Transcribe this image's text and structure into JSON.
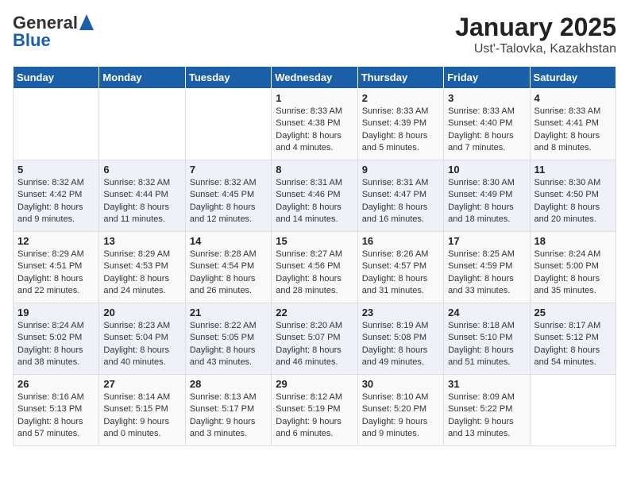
{
  "logo": {
    "general": "General",
    "blue": "Blue"
  },
  "title": "January 2025",
  "subtitle": "Ust'-Talovka, Kazakhstan",
  "days_of_week": [
    "Sunday",
    "Monday",
    "Tuesday",
    "Wednesday",
    "Thursday",
    "Friday",
    "Saturday"
  ],
  "weeks": [
    [
      {
        "day": "",
        "sunrise": "",
        "sunset": "",
        "daylight": "",
        "empty": true
      },
      {
        "day": "",
        "sunrise": "",
        "sunset": "",
        "daylight": "",
        "empty": true
      },
      {
        "day": "",
        "sunrise": "",
        "sunset": "",
        "daylight": "",
        "empty": true
      },
      {
        "day": "1",
        "sunrise": "Sunrise: 8:33 AM",
        "sunset": "Sunset: 4:38 PM",
        "daylight": "Daylight: 8 hours and 4 minutes."
      },
      {
        "day": "2",
        "sunrise": "Sunrise: 8:33 AM",
        "sunset": "Sunset: 4:39 PM",
        "daylight": "Daylight: 8 hours and 5 minutes."
      },
      {
        "day": "3",
        "sunrise": "Sunrise: 8:33 AM",
        "sunset": "Sunset: 4:40 PM",
        "daylight": "Daylight: 8 hours and 7 minutes."
      },
      {
        "day": "4",
        "sunrise": "Sunrise: 8:33 AM",
        "sunset": "Sunset: 4:41 PM",
        "daylight": "Daylight: 8 hours and 8 minutes."
      }
    ],
    [
      {
        "day": "5",
        "sunrise": "Sunrise: 8:32 AM",
        "sunset": "Sunset: 4:42 PM",
        "daylight": "Daylight: 8 hours and 9 minutes."
      },
      {
        "day": "6",
        "sunrise": "Sunrise: 8:32 AM",
        "sunset": "Sunset: 4:44 PM",
        "daylight": "Daylight: 8 hours and 11 minutes."
      },
      {
        "day": "7",
        "sunrise": "Sunrise: 8:32 AM",
        "sunset": "Sunset: 4:45 PM",
        "daylight": "Daylight: 8 hours and 12 minutes."
      },
      {
        "day": "8",
        "sunrise": "Sunrise: 8:31 AM",
        "sunset": "Sunset: 4:46 PM",
        "daylight": "Daylight: 8 hours and 14 minutes."
      },
      {
        "day": "9",
        "sunrise": "Sunrise: 8:31 AM",
        "sunset": "Sunset: 4:47 PM",
        "daylight": "Daylight: 8 hours and 16 minutes."
      },
      {
        "day": "10",
        "sunrise": "Sunrise: 8:30 AM",
        "sunset": "Sunset: 4:49 PM",
        "daylight": "Daylight: 8 hours and 18 minutes."
      },
      {
        "day": "11",
        "sunrise": "Sunrise: 8:30 AM",
        "sunset": "Sunset: 4:50 PM",
        "daylight": "Daylight: 8 hours and 20 minutes."
      }
    ],
    [
      {
        "day": "12",
        "sunrise": "Sunrise: 8:29 AM",
        "sunset": "Sunset: 4:51 PM",
        "daylight": "Daylight: 8 hours and 22 minutes."
      },
      {
        "day": "13",
        "sunrise": "Sunrise: 8:29 AM",
        "sunset": "Sunset: 4:53 PM",
        "daylight": "Daylight: 8 hours and 24 minutes."
      },
      {
        "day": "14",
        "sunrise": "Sunrise: 8:28 AM",
        "sunset": "Sunset: 4:54 PM",
        "daylight": "Daylight: 8 hours and 26 minutes."
      },
      {
        "day": "15",
        "sunrise": "Sunrise: 8:27 AM",
        "sunset": "Sunset: 4:56 PM",
        "daylight": "Daylight: 8 hours and 28 minutes."
      },
      {
        "day": "16",
        "sunrise": "Sunrise: 8:26 AM",
        "sunset": "Sunset: 4:57 PM",
        "daylight": "Daylight: 8 hours and 31 minutes."
      },
      {
        "day": "17",
        "sunrise": "Sunrise: 8:25 AM",
        "sunset": "Sunset: 4:59 PM",
        "daylight": "Daylight: 8 hours and 33 minutes."
      },
      {
        "day": "18",
        "sunrise": "Sunrise: 8:24 AM",
        "sunset": "Sunset: 5:00 PM",
        "daylight": "Daylight: 8 hours and 35 minutes."
      }
    ],
    [
      {
        "day": "19",
        "sunrise": "Sunrise: 8:24 AM",
        "sunset": "Sunset: 5:02 PM",
        "daylight": "Daylight: 8 hours and 38 minutes."
      },
      {
        "day": "20",
        "sunrise": "Sunrise: 8:23 AM",
        "sunset": "Sunset: 5:04 PM",
        "daylight": "Daylight: 8 hours and 40 minutes."
      },
      {
        "day": "21",
        "sunrise": "Sunrise: 8:22 AM",
        "sunset": "Sunset: 5:05 PM",
        "daylight": "Daylight: 8 hours and 43 minutes."
      },
      {
        "day": "22",
        "sunrise": "Sunrise: 8:20 AM",
        "sunset": "Sunset: 5:07 PM",
        "daylight": "Daylight: 8 hours and 46 minutes."
      },
      {
        "day": "23",
        "sunrise": "Sunrise: 8:19 AM",
        "sunset": "Sunset: 5:08 PM",
        "daylight": "Daylight: 8 hours and 49 minutes."
      },
      {
        "day": "24",
        "sunrise": "Sunrise: 8:18 AM",
        "sunset": "Sunset: 5:10 PM",
        "daylight": "Daylight: 8 hours and 51 minutes."
      },
      {
        "day": "25",
        "sunrise": "Sunrise: 8:17 AM",
        "sunset": "Sunset: 5:12 PM",
        "daylight": "Daylight: 8 hours and 54 minutes."
      }
    ],
    [
      {
        "day": "26",
        "sunrise": "Sunrise: 8:16 AM",
        "sunset": "Sunset: 5:13 PM",
        "daylight": "Daylight: 8 hours and 57 minutes."
      },
      {
        "day": "27",
        "sunrise": "Sunrise: 8:14 AM",
        "sunset": "Sunset: 5:15 PM",
        "daylight": "Daylight: 9 hours and 0 minutes."
      },
      {
        "day": "28",
        "sunrise": "Sunrise: 8:13 AM",
        "sunset": "Sunset: 5:17 PM",
        "daylight": "Daylight: 9 hours and 3 minutes."
      },
      {
        "day": "29",
        "sunrise": "Sunrise: 8:12 AM",
        "sunset": "Sunset: 5:19 PM",
        "daylight": "Daylight: 9 hours and 6 minutes."
      },
      {
        "day": "30",
        "sunrise": "Sunrise: 8:10 AM",
        "sunset": "Sunset: 5:20 PM",
        "daylight": "Daylight: 9 hours and 9 minutes."
      },
      {
        "day": "31",
        "sunrise": "Sunrise: 8:09 AM",
        "sunset": "Sunset: 5:22 PM",
        "daylight": "Daylight: 9 hours and 13 minutes."
      },
      {
        "day": "",
        "sunrise": "",
        "sunset": "",
        "daylight": "",
        "empty": true
      }
    ]
  ]
}
